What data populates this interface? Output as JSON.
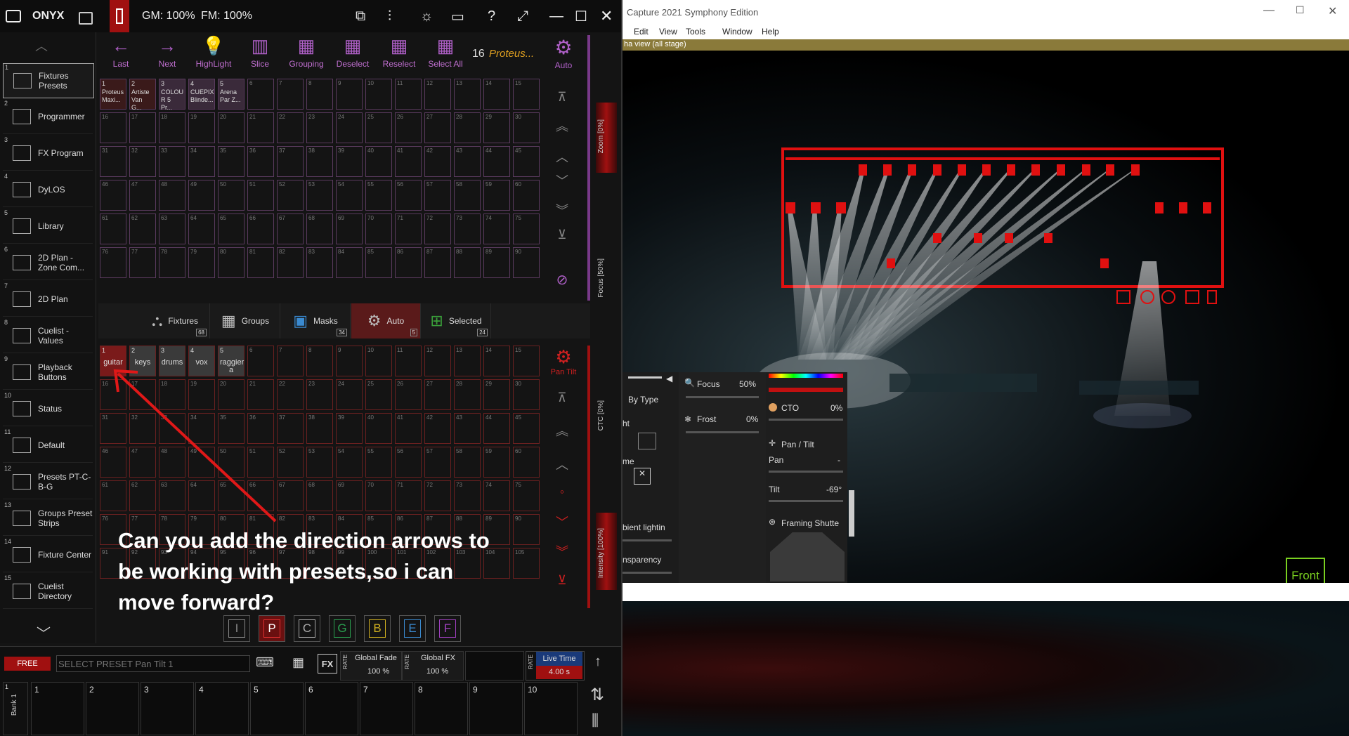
{
  "onyx": {
    "brand": "ONYX",
    "gm": "GM: 100%",
    "fm": "FM: 100%",
    "sidebar": [
      {
        "num": "1",
        "label": "Fixtures Presets"
      },
      {
        "num": "2",
        "label": "Programmer"
      },
      {
        "num": "3",
        "label": "FX Program"
      },
      {
        "num": "4",
        "label": "DyLOS"
      },
      {
        "num": "5",
        "label": "Library"
      },
      {
        "num": "6",
        "label": "2D Plan - Zone Com..."
      },
      {
        "num": "7",
        "label": "2D Plan"
      },
      {
        "num": "8",
        "label": "Cuelist - Values"
      },
      {
        "num": "9",
        "label": "Playback Buttons"
      },
      {
        "num": "10",
        "label": "Status"
      },
      {
        "num": "11",
        "label": "Default"
      },
      {
        "num": "12",
        "label": "Presets PT-C-B-G"
      },
      {
        "num": "13",
        "label": "Groups Preset Strips"
      },
      {
        "num": "14",
        "label": "Fixture Center"
      },
      {
        "num": "15",
        "label": "Cuelist Directory"
      }
    ],
    "toolbar": [
      {
        "label": "Last",
        "glyph": "←"
      },
      {
        "label": "Next",
        "glyph": "→"
      },
      {
        "label": "HighLight",
        "glyph": "💡"
      },
      {
        "label": "Slice",
        "glyph": "▥"
      },
      {
        "label": "Grouping",
        "glyph": "▦"
      },
      {
        "label": "Deselect",
        "glyph": "▦"
      },
      {
        "label": "Reselect",
        "glyph": "▦"
      },
      {
        "label": "Select All",
        "glyph": "▦"
      }
    ],
    "selection_count": "16",
    "selection_name": "Proteus...",
    "auto_label": "Auto",
    "fixture_cells": [
      {
        "num": "1",
        "text": "Proteus Maxi..."
      },
      {
        "num": "2",
        "text": "Artiste Van G..."
      },
      {
        "num": "3",
        "text": "COLOU R 5 Pr..."
      },
      {
        "num": "4",
        "text": "CUEPIX Blinde..."
      },
      {
        "num": "5",
        "text": "Arena Par Z..."
      }
    ],
    "zoom_label": "Zoom [0%]",
    "focus_label": "Focus [50%]",
    "tabs": [
      {
        "label": "Fixtures",
        "badge": "68",
        "icon": "fixture-icon"
      },
      {
        "label": "Groups",
        "badge": "",
        "icon": "grid-icon"
      },
      {
        "label": "Masks",
        "badge": "34",
        "icon": "masks-icon"
      },
      {
        "label": "Auto",
        "badge": "5",
        "icon": "gear-icon"
      },
      {
        "label": "Selected",
        "badge": "24",
        "icon": "plus-icon"
      }
    ],
    "preset_cells": [
      {
        "num": "1",
        "text": "guitar"
      },
      {
        "num": "2",
        "text": "keys"
      },
      {
        "num": "3",
        "text": "drums"
      },
      {
        "num": "4",
        "text": "vox"
      },
      {
        "num": "5",
        "text": "raggier a"
      }
    ],
    "pan_tilt_label": "Pan Tilt",
    "ctc_label": "CTC [0%]",
    "intensity_label": "Intensity [100%]",
    "preset_buttons": [
      "I",
      "P",
      "C",
      "G",
      "B",
      "E",
      "F"
    ],
    "free_label": "FREE",
    "command_placeholder": "SELECT PRESET Pan Tilt 1",
    "fx_label": "FX",
    "rate_label": "RATE",
    "global_fade_label": "Global Fade",
    "global_fade_value": "100 %",
    "global_fx_label": "Global FX",
    "global_fx_value": "100 %",
    "live_time_label": "Live Time",
    "live_time_value": "4.00 s",
    "bank_label": "Bank 1",
    "bank_num": "1",
    "banks": [
      "1",
      "2",
      "3",
      "4",
      "5",
      "6",
      "7",
      "8",
      "9",
      "10"
    ],
    "annotation": "Can you add the direction arrows to be working with presets,so i can move forward?"
  },
  "capture": {
    "title": "Capture 2021 Symphony Edition",
    "menu": [
      "Edit",
      "View",
      "Tools",
      "Window",
      "Help"
    ],
    "alpha_view": "ha view  (all stage)",
    "focus_label": "Focus",
    "focus_value": "50%",
    "frost_label": "Frost",
    "frost_value": "0%",
    "cto_label": "CTO",
    "cto_value": "0%",
    "pan_tilt_label": "Pan / Tilt",
    "pan_label": "Pan",
    "pan_value": "-",
    "tilt_label": "Tilt",
    "tilt_value": "-69°",
    "framing_label": "Framing Shutte",
    "by_type_label": "By Type",
    "partial_labels": [
      "ht",
      "me",
      "bient lightin",
      "nsparency"
    ],
    "front_label": "Front"
  },
  "colors": {
    "accent_purple": "#b060c8",
    "accent_red": "#a01010",
    "capture_stage_red": "#e01010",
    "front_green": "#7ad020"
  }
}
